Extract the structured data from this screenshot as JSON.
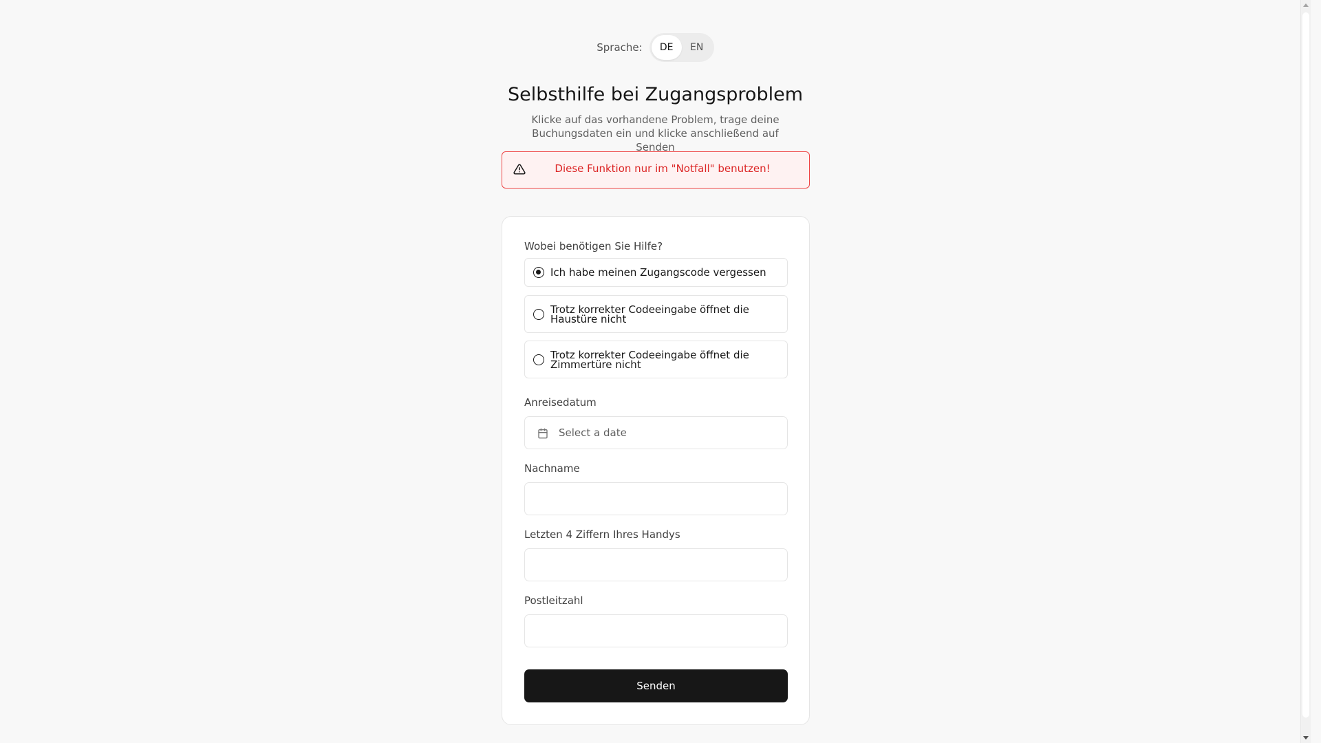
{
  "language": {
    "label": "Sprache:",
    "options": [
      "DE",
      "EN"
    ],
    "selected": "DE"
  },
  "header": {
    "title": "Selbsthilfe bei Zugangsproblem",
    "subtitle": "Klicke auf das vorhandene Problem, trage deine Buchungsdaten ein und klicke anschließend auf Senden"
  },
  "alert": {
    "icon": "warning-triangle-icon",
    "text": "Diese Funktion nur im \"Notfall\" benutzen!",
    "color": "#dc2626"
  },
  "form": {
    "question_label": "Wobei benötigen Sie Hilfe?",
    "options": [
      {
        "label": "Ich habe meinen Zugangscode vergessen",
        "checked": true
      },
      {
        "label": "Trotz korrekter Codeeingabe öffnet die Haustüre nicht",
        "checked": false
      },
      {
        "label": "Trotz korrekter Codeeingabe öffnet die Zimmertüre nicht",
        "checked": false
      }
    ],
    "arrival_date": {
      "label": "Anreisedatum",
      "placeholder": "Select a date",
      "icon": "calendar-icon"
    },
    "last_name": {
      "label": "Nachname",
      "value": ""
    },
    "phone_digits": {
      "label": "Letzten 4 Ziffern Ihres Handys",
      "value": ""
    },
    "postal_code": {
      "label": "Postleitzahl",
      "value": ""
    },
    "submit_label": "Senden"
  }
}
